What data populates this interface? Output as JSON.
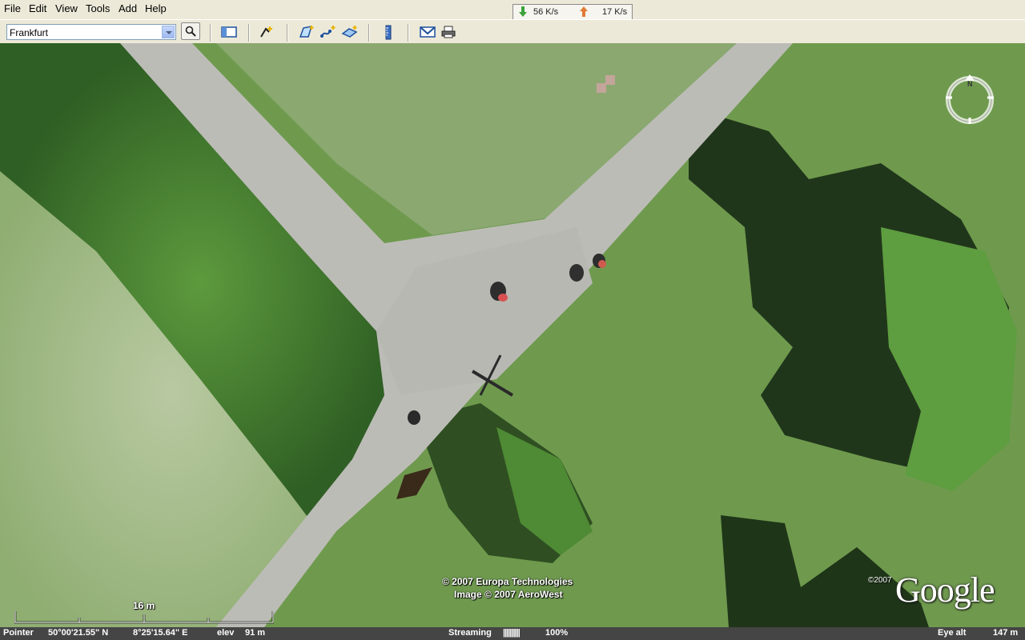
{
  "menu": [
    "File",
    "Edit",
    "View",
    "Tools",
    "Add",
    "Help"
  ],
  "network": {
    "down": "56 K/s",
    "up": "17 K/s"
  },
  "search": {
    "value": "Frankfurt"
  },
  "toolbar_icons": [
    "sidebar-toggle-icon",
    "placemark-icon",
    "polygon-icon",
    "path-icon",
    "image-overlay-icon",
    "ruler-icon",
    "email-icon",
    "print-icon"
  ],
  "map": {
    "copyright_line1": "© 2007 Europa Technologies",
    "copyright_line2": "Image © 2007 AeroWest",
    "google_year": "©2007",
    "google_logo": "Google",
    "scale_label": "16 m"
  },
  "status": {
    "pointer_label": "Pointer",
    "lat": "50°00'21.55\" N",
    "lon": "8°25'15.64\" E",
    "elev_label": "elev",
    "elev": "91 m",
    "streaming_label": "Streaming",
    "streaming_bar": "||||||||||",
    "streaming_pct": "100%",
    "eye_alt_label": "Eye alt",
    "eye_alt": "147 m"
  }
}
